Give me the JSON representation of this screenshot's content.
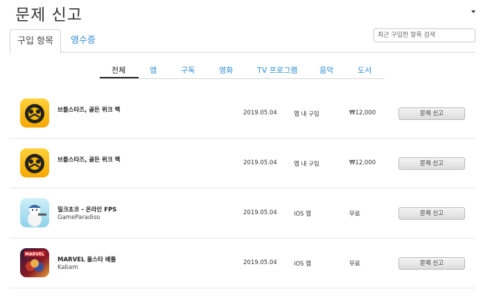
{
  "header": {
    "title": "문제 신고"
  },
  "tabs": [
    {
      "label": "구입 항목",
      "active": true
    },
    {
      "label": "영수증",
      "active": false
    }
  ],
  "search": {
    "placeholder": "최근 구입한 항목 검색"
  },
  "filters": [
    {
      "label": "전체",
      "active": true
    },
    {
      "label": "앱",
      "active": false
    },
    {
      "label": "구독",
      "active": false
    },
    {
      "label": "영화",
      "active": false
    },
    {
      "label": "TV 프로그램",
      "active": false
    },
    {
      "label": "음악",
      "active": false
    },
    {
      "label": "도서",
      "active": false
    }
  ],
  "purchases": [
    {
      "name": "브롤스타즈, 골든 위크 팩",
      "developer": "",
      "date": "2019.05.04",
      "type": "앱 내 구입",
      "price": "₩12,000",
      "icon": "brawl-stars-icon",
      "button": "문제 신고"
    },
    {
      "name": "브롤스타즈, 골든 위크 팩",
      "developer": "",
      "date": "2019.05.04",
      "type": "앱 내 구입",
      "price": "₩12,000",
      "icon": "brawl-stars-icon",
      "button": "문제 신고"
    },
    {
      "name": "밀크초코 - 온라인 FPS",
      "developer": "GameParadiso",
      "date": "2019.05.04",
      "type": "iOS 앱",
      "price": "무료",
      "icon": "milkchoco-icon",
      "button": "문제 신고"
    },
    {
      "name": "MARVEL 올스타 배틀",
      "developer": "Kabam",
      "date": "2019.05.04",
      "type": "iOS 앱",
      "price": "무료",
      "icon": "marvel-icon",
      "button": "문제 신고"
    }
  ],
  "colors": {
    "accent": "#2a8ad4",
    "brawl_yellow": "#f5b800",
    "divider": "#d9d9d9"
  }
}
